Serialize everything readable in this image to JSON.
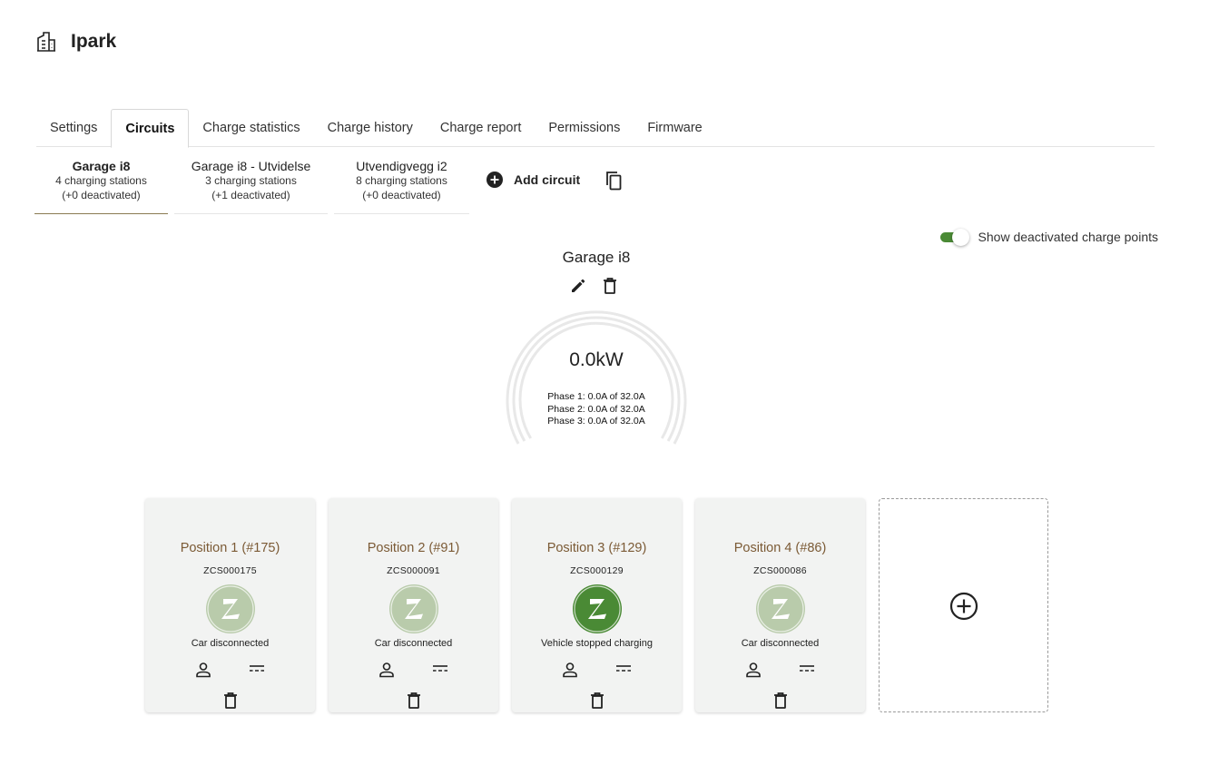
{
  "header": {
    "title": "Ipark",
    "icon": "building-icon"
  },
  "tabs": [
    {
      "label": "Settings",
      "active": false
    },
    {
      "label": "Circuits",
      "active": true
    },
    {
      "label": "Charge statistics",
      "active": false
    },
    {
      "label": "Charge history",
      "active": false
    },
    {
      "label": "Charge report",
      "active": false
    },
    {
      "label": "Permissions",
      "active": false
    },
    {
      "label": "Firmware",
      "active": false
    }
  ],
  "circuits": [
    {
      "name": "Garage i8",
      "stations": "4 charging stations",
      "deactivated": "(+0 deactivated)",
      "active": true
    },
    {
      "name": "Garage i8 - Utvidelse",
      "stations": "3 charging stations",
      "deactivated": "(+1 deactivated)",
      "active": false
    },
    {
      "name": "Utvendigvegg i2",
      "stations": "8 charging stations",
      "deactivated": "(+0 deactivated)",
      "active": false
    }
  ],
  "add_circuit_label": "Add circuit",
  "toggle": {
    "label": "Show deactivated charge points",
    "checked": true
  },
  "selected_circuit": {
    "name": "Garage i8",
    "power": "0.0kW",
    "phases": [
      "Phase 1: 0.0A of 32.0A",
      "Phase 2: 0.0A of 32.0A",
      "Phase 3: 0.0A of 32.0A"
    ]
  },
  "charge_points": [
    {
      "position": "Position 1 (#175)",
      "serial": "ZCS000175",
      "status": "Car disconnected",
      "logo_color": "#b9cbab"
    },
    {
      "position": "Position 2 (#91)",
      "serial": "ZCS000091",
      "status": "Car disconnected",
      "logo_color": "#b9cbab"
    },
    {
      "position": "Position 3 (#129)",
      "serial": "ZCS000129",
      "status": "Vehicle stopped charging",
      "logo_color": "#4a8a35"
    },
    {
      "position": "Position 4 (#86)",
      "serial": "ZCS000086",
      "status": "Car disconnected",
      "logo_color": "#b9cbab"
    }
  ],
  "colors": {
    "accent": "#4a8a35",
    "position_text": "#7b5a35",
    "card_bg": "#f2f3f2"
  }
}
